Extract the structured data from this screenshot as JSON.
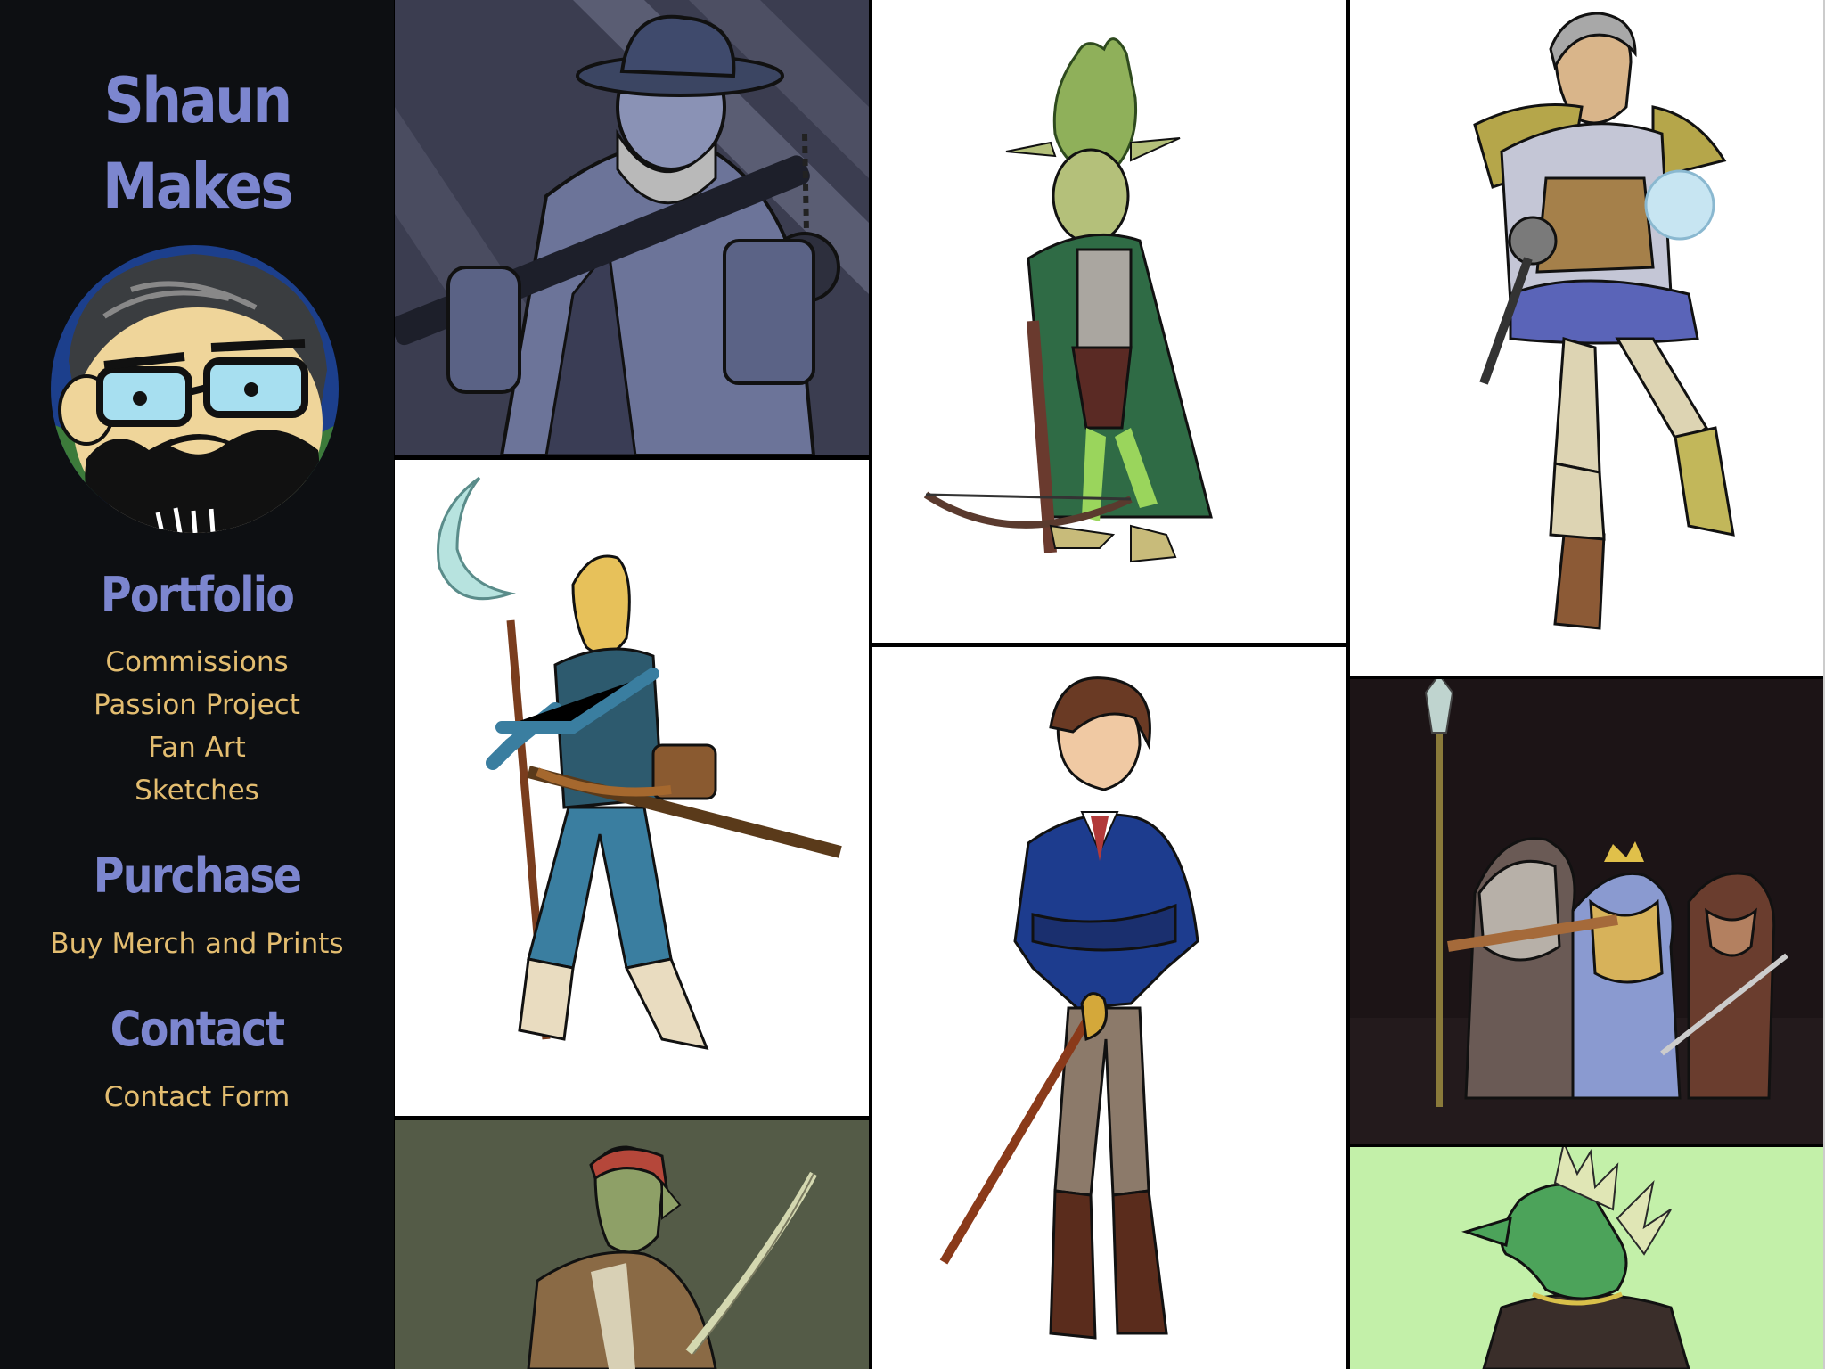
{
  "site": {
    "title_line1": "Shaun",
    "title_line2": "Makes"
  },
  "nav": {
    "portfolio": {
      "heading": "Portfolio",
      "links": [
        "Commissions",
        "Passion Project",
        "Fan Art",
        "Sketches"
      ]
    },
    "purchase": {
      "heading": "Purchase",
      "links": [
        "Buy Merch and Prints"
      ]
    },
    "contact": {
      "heading": "Contact",
      "links": [
        "Contact Form"
      ]
    }
  },
  "gallery": {
    "items": [
      "artwork-bowler-hat-gentleman-with-flail",
      "artwork-green-goblin-crossbow",
      "artwork-armored-mage-with-orb",
      "artwork-blonde-elf-with-crescent-staff",
      "artwork-young-swordsman-blue-coat",
      "artwork-dwarf-party",
      "artwork-orc-pirate-with-sabre",
      "artwork-green-dragonborn"
    ]
  },
  "colors": {
    "sidebar_bg": "#0d0f12",
    "heading": "#7c86cf",
    "link": "#e3bd70"
  }
}
